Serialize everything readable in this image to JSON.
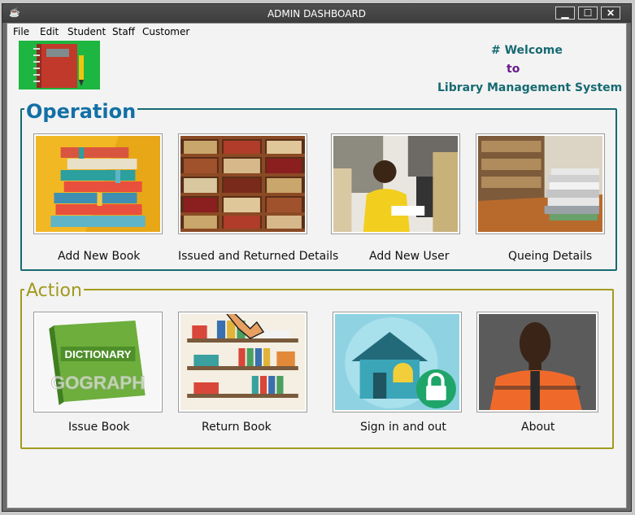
{
  "window": {
    "title": "ADMIN DASHBOARD",
    "controls": {
      "minimize": "▁",
      "maximize": "☐",
      "close": "✕"
    }
  },
  "menu": [
    "File",
    "Edit",
    "Student",
    "Staff",
    "Customer"
  ],
  "welcome": {
    "line1": "# Welcome",
    "line2": "to",
    "line3": "Library Management System"
  },
  "operation": {
    "title": "Operation",
    "tiles": [
      {
        "label": "Add New Book",
        "icon": "book-stack-icon"
      },
      {
        "label": "Issued and Returned Details",
        "icon": "bookshelf-icon"
      },
      {
        "label": "Add New User",
        "icon": "student-reading-icon"
      },
      {
        "label": "Queing Details",
        "icon": "library-books-icon"
      }
    ]
  },
  "action": {
    "title": "Action",
    "tiles": [
      {
        "label": "Issue Book",
        "icon": "dictionary-icon",
        "image_text": "DICTIONARY",
        "watermark": "GOGRAPH"
      },
      {
        "label": "Return Book",
        "icon": "shelves-icon"
      },
      {
        "label": "Sign in and out",
        "icon": "house-lock-icon"
      },
      {
        "label": "About",
        "icon": "person-photo-icon"
      }
    ]
  },
  "colors": {
    "operation_border": "#176a71",
    "operation_title": "#1370a6",
    "action_border": "#a39a1e",
    "welcome_teal": "#176a71",
    "welcome_purple": "#6b1a8c"
  }
}
